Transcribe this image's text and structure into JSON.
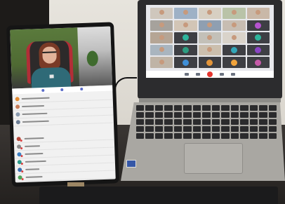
{
  "scene": {
    "colors": {
      "tablet_bezel": "#151515",
      "laptop_lid": "#2c2c2e",
      "laptop_base": "#a9a7a2",
      "meeting_end_button": "#e5352f",
      "tablet_accent": "#5b6cc8"
    },
    "zoom_tiles": [
      {
        "kind": "video",
        "bg": "#cfc7bd"
      },
      {
        "kind": "video",
        "bg": "#9eb1c6"
      },
      {
        "kind": "video",
        "bg": "#d7cfc2"
      },
      {
        "kind": "video",
        "bg": "#b9c3a8"
      },
      {
        "kind": "video",
        "bg": "#c9b8a8"
      },
      {
        "kind": "video",
        "bg": "#a6a29c"
      },
      {
        "kind": "video",
        "bg": "#d2c5b6"
      },
      {
        "kind": "video",
        "bg": "#8f9fb1"
      },
      {
        "kind": "video",
        "bg": "#c7bdb2"
      },
      {
        "kind": "avatar",
        "bg": "#3e3f44",
        "avatar": "#b653d0"
      },
      {
        "kind": "video",
        "bg": "#b5a595"
      },
      {
        "kind": "avatar",
        "bg": "#3e3f44",
        "avatar": "#2fb59c"
      },
      {
        "kind": "video",
        "bg": "#c3c0b8"
      },
      {
        "kind": "video",
        "bg": "#d9d3ca"
      },
      {
        "kind": "avatar",
        "bg": "#3e3f44",
        "avatar": "#2fb59c"
      },
      {
        "kind": "video",
        "bg": "#a9b5bf"
      },
      {
        "kind": "avatar",
        "bg": "#3e3f44",
        "avatar": "#2c9c80"
      },
      {
        "kind": "video",
        "bg": "#cbbfae"
      },
      {
        "kind": "avatar",
        "bg": "#3e3f44",
        "avatar": "#32a6b8"
      },
      {
        "kind": "avatar",
        "bg": "#3e3f44",
        "avatar": "#8a45c4"
      },
      {
        "kind": "video",
        "bg": "#bfb4a6"
      },
      {
        "kind": "avatar",
        "bg": "#3e3f44",
        "avatar": "#3f8fd8"
      },
      {
        "kind": "avatar",
        "bg": "#3e3f44",
        "avatar": "#e3953a"
      },
      {
        "kind": "avatar",
        "bg": "#3e3f44",
        "avatar": "#f0a33c"
      },
      {
        "kind": "avatar",
        "bg": "#3e3f44",
        "avatar": "#c45aa8"
      }
    ],
    "tablet_participants": [
      {
        "avatar": "#e38b33",
        "line": 40,
        "badge": false
      },
      {
        "avatar": "#c87d5a",
        "line": 32,
        "badge": false
      },
      {
        "avatar": "#8a9bb0",
        "line": 36,
        "badge": false
      },
      {
        "avatar": "#6c7e96",
        "line": 38,
        "badge": false
      },
      {
        "section": true
      },
      {
        "avatar": "#b54b3d",
        "line": 28,
        "badge": true
      },
      {
        "avatar": "#8a8a8a",
        "line": 22,
        "badge": true
      },
      {
        "avatar": "#3d7fc2",
        "line": 26,
        "badge": true
      },
      {
        "avatar": "#2b9a8a",
        "line": 30,
        "badge": true
      },
      {
        "avatar": "#3a6fb2",
        "line": 20,
        "badge": true
      },
      {
        "avatar": "#4fa35a",
        "line": 24,
        "badge": true
      }
    ]
  }
}
